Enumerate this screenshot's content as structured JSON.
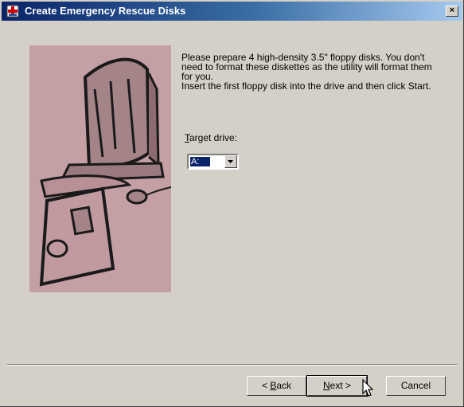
{
  "window": {
    "title": "Create Emergency Rescue Disks",
    "close_label": "×"
  },
  "message": {
    "line1": "Please prepare 4 high-density 3.5\" floppy disks. You don't need to format these diskettes as the utility will format them for you.",
    "line2": "Insert the first floppy disk into the drive and then click Start."
  },
  "target_drive": {
    "label_mnemonic": "T",
    "label_rest": "arget drive:",
    "selected_value": "A:"
  },
  "buttons": {
    "back_prefix": "< ",
    "back_mnemonic": "B",
    "back_rest": "ack",
    "next_mnemonic": "N",
    "next_rest": "ext >",
    "cancel": "Cancel"
  },
  "colors": {
    "titlebar_start": "#0a246a",
    "titlebar_end": "#a6caf0",
    "face": "#d4d0c8",
    "illustration_bg": "#c8a4a8"
  },
  "icons": {
    "title_icon": "rescue-cross-icon",
    "dropdown_arrow": "chevron-down-icon",
    "cursor": "mouse-pointer-icon"
  }
}
